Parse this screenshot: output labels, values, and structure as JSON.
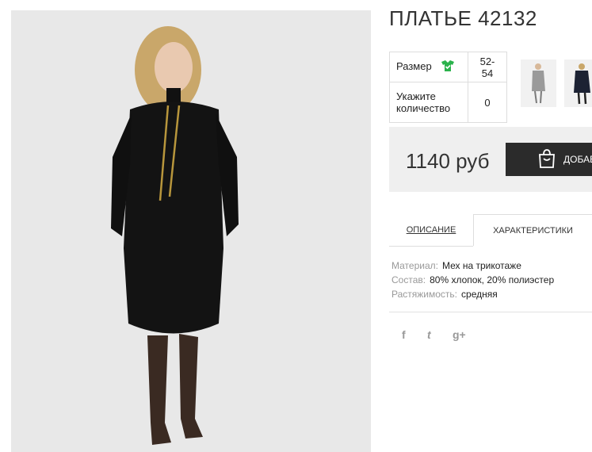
{
  "product": {
    "title": "ПЛАТЬЕ 42132",
    "options": [
      {
        "label": "Размер",
        "value": "52-54"
      },
      {
        "label": "Укажите количество",
        "value": "0"
      }
    ],
    "price": "1140 руб",
    "add_to_cart_label": "ДОБАВ"
  },
  "tabs": [
    {
      "label": "ОПИСАНИЕ",
      "active": false
    },
    {
      "label": "ХАРАКТЕРИСТИКИ",
      "active": true
    }
  ],
  "characteristics": [
    {
      "key": "Материал:",
      "value": "Мех на трикотаже"
    },
    {
      "key": "Состав:",
      "value": "80% хлопок, 20% полиэстер"
    },
    {
      "key": "Растяжимость:",
      "value": "средняя"
    }
  ],
  "social": [
    {
      "icon": "facebook-icon",
      "glyph": "f"
    },
    {
      "icon": "twitter-icon",
      "glyph": "t"
    },
    {
      "icon": "google-plus-icon",
      "glyph": "g+"
    }
  ],
  "colors": {
    "accent_green": "#2bb24c",
    "button_dark": "#2b2b2b",
    "price_bg": "#efefef"
  }
}
